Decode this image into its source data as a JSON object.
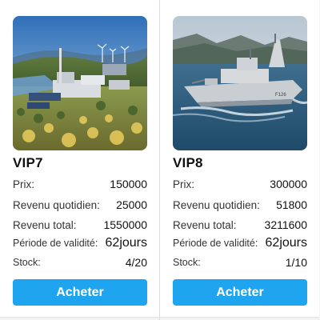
{
  "colors": {
    "accent": "#1fa4f0",
    "card_bg": "#ffffff",
    "page_bg": "#f3f3f3"
  },
  "products": [
    {
      "name": "VIP7",
      "image_icon": "industrial-plant-image",
      "price_label": "Prix:",
      "price": "150000",
      "daily_label": "Revenu quotidien:",
      "daily": "25000",
      "total_label": "Revenu total:",
      "total": "1550000",
      "validity_label": "Période de validité:",
      "validity": "62jours",
      "stock_label": "Stock:",
      "stock": "4/20",
      "button": "Acheter"
    },
    {
      "name": "VIP8",
      "image_icon": "warship-image",
      "price_label": "Prix:",
      "price": "300000",
      "daily_label": "Revenu quotidien:",
      "daily": "51800",
      "total_label": "Revenu total:",
      "total": "3211600",
      "validity_label": "Période de validité:",
      "validity": "62jours",
      "stock_label": "Stock:",
      "stock": "1/10",
      "button": "Acheter"
    }
  ]
}
